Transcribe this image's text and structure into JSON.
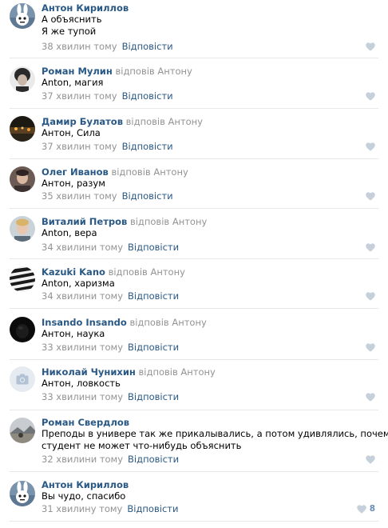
{
  "comments": [
    {
      "author": "Антон Кириллов",
      "reply_to": "",
      "lines": [
        "А объяснить",
        "Я же тупой"
      ],
      "time": "38 хвилин тому",
      "reply_label": "Відповісти",
      "likes": "",
      "avatar": "rabbit-avatar"
    },
    {
      "author": "Роман Мулин",
      "reply_to": "відповів Антону",
      "lines": [
        "Anton, магия"
      ],
      "time": "37 хвилин тому",
      "reply_label": "Відповісти",
      "likes": "",
      "avatar": "portrait-avatar"
    },
    {
      "author": "Дамир Булатов",
      "reply_to": "відповів Антону",
      "lines": [
        "Антон, Сила"
      ],
      "time": "37 хвилин тому",
      "reply_label": "Відповісти",
      "likes": "",
      "avatar": "night-lights-avatar"
    },
    {
      "author": "Олег Иванов",
      "reply_to": "відповів Антону",
      "lines": [
        "Антон, разум"
      ],
      "time": "35 хвилин тому",
      "reply_label": "Відповісти",
      "likes": "",
      "avatar": "person-avatar"
    },
    {
      "author": "Виталий Петров",
      "reply_to": "відповів Антону",
      "lines": [
        "Anton, вера"
      ],
      "time": "34 хвилини тому",
      "reply_label": "Відповісти",
      "likes": "",
      "avatar": "blond-person-avatar"
    },
    {
      "author": "Kazuki Kano",
      "reply_to": "відповів Антону",
      "lines": [
        "Anton, харизма"
      ],
      "time": "34 хвилини тому",
      "reply_label": "Відповісти",
      "likes": "",
      "avatar": "zebra-avatar"
    },
    {
      "author": "Insando Insando",
      "reply_to": "відповів Антону",
      "lines": [
        "Антон, наука"
      ],
      "time": "33 хвилини тому",
      "reply_label": "Відповісти",
      "likes": "",
      "avatar": "dark-avatar"
    },
    {
      "author": "Николай Чунихин",
      "reply_to": "відповів Антону",
      "lines": [
        "Антон, ловкость"
      ],
      "time": "33 хвилини тому",
      "reply_label": "Відповісти",
      "likes": "",
      "avatar": "camera-placeholder-avatar"
    },
    {
      "author": "Роман Свердлов",
      "reply_to": "",
      "lines": [
        "Преподы в универе так же прикалывались, а потом удивлялись, почему",
        "студент не может что-нибудь объяснить"
      ],
      "time": "32 хвилини тому",
      "reply_label": "Відповісти",
      "likes": "",
      "avatar": "landscape-avatar"
    },
    {
      "author": "Антон Кириллов",
      "reply_to": "",
      "lines": [
        "Вы чудо, спасибо"
      ],
      "time": "31 хвилину тому",
      "reply_label": "Відповісти",
      "likes": "8",
      "avatar": "rabbit-avatar"
    }
  ],
  "colors": {
    "author": "#2a5885",
    "secondary_text": "#939393",
    "like_icon": "#c5d0db",
    "like_count": "#6b8db5",
    "separator": "#e7e8ec"
  }
}
